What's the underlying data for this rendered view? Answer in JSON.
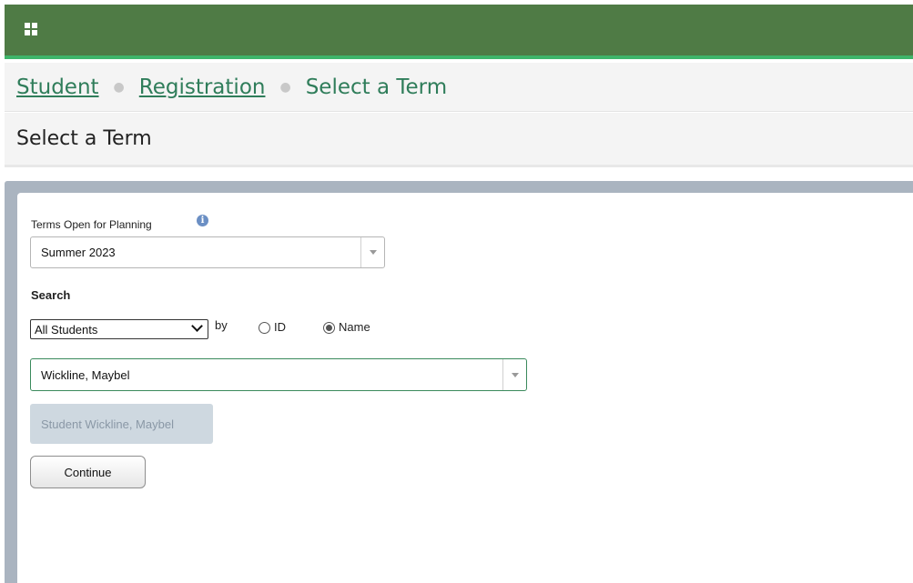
{
  "header": {
    "menu_icon": "app-grid-icon",
    "colors": {
      "bar": "#4f7b45",
      "accent_line": "#3fb56a"
    }
  },
  "breadcrumb": {
    "items": [
      {
        "label": "Student"
      },
      {
        "label": "Registration"
      },
      {
        "label": "Select a Term"
      }
    ]
  },
  "page": {
    "title": "Select a Term"
  },
  "form": {
    "term_label": "Terms Open for Planning",
    "info_icon": "info-icon",
    "term_value": "Summer 2023",
    "search_label": "Search",
    "student_filter_value": "All Students",
    "by_label": "by",
    "radio_id_label": "ID",
    "radio_name_label": "Name",
    "selected_search_mode": "Name",
    "student_value": "Wickline, Maybel",
    "suggestion": "Student Wickline, Maybel",
    "continue_label": "Continue"
  }
}
